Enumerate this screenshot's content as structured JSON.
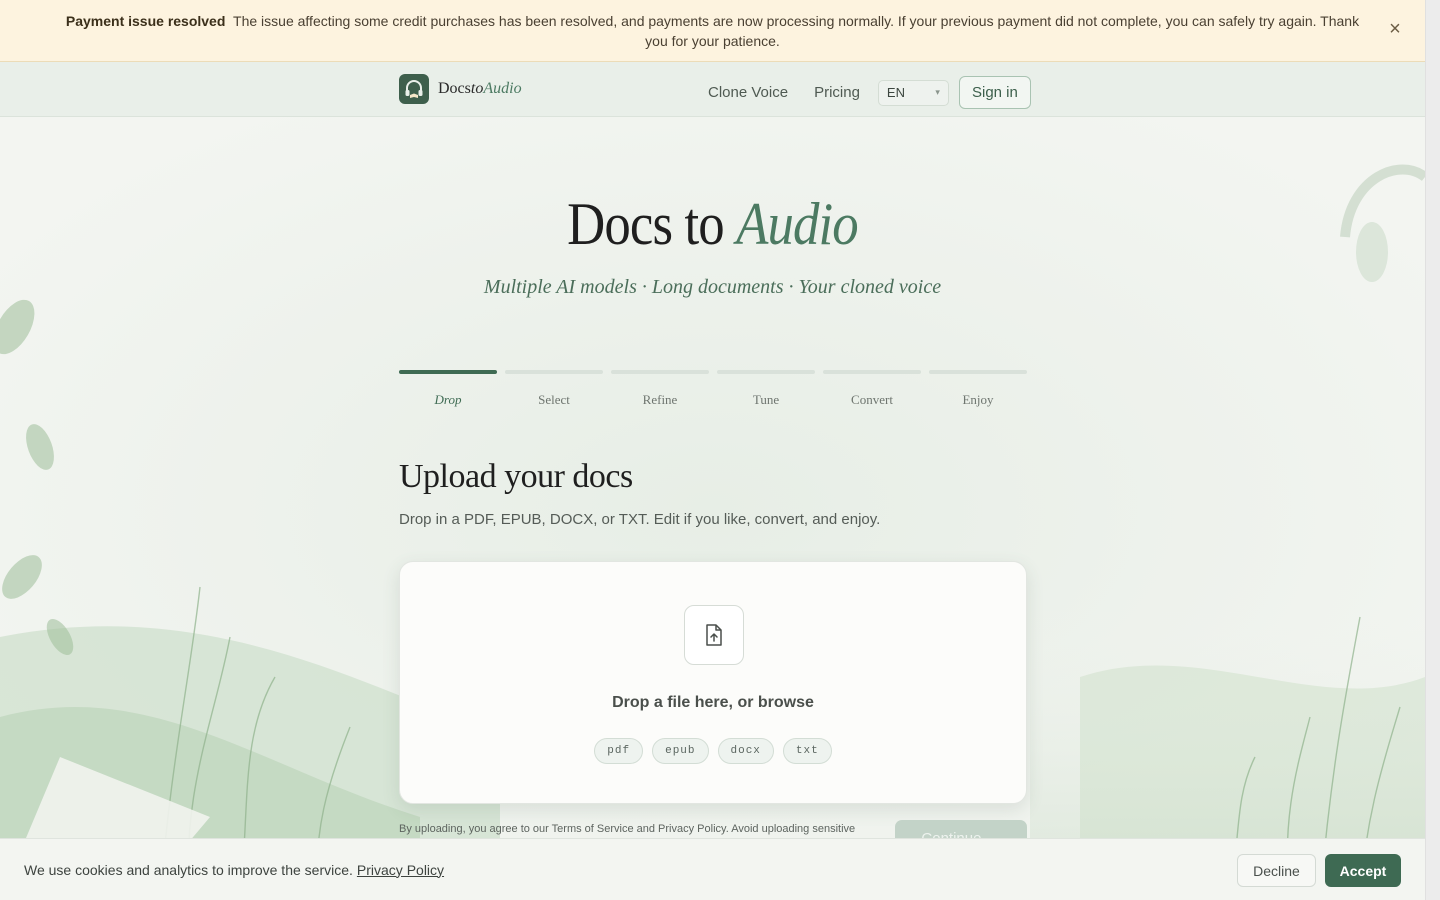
{
  "banner": {
    "title": "Payment issue resolved",
    "message": "The issue affecting some credit purchases has been resolved, and payments are now processing normally. If your previous payment did not complete, you can safely try again. Thank you for your patience.",
    "close_icon": "×"
  },
  "header": {
    "logo_docs": "Docs",
    "logo_to": "to",
    "logo_audio": "Audio",
    "nav": [
      "Clone Voice",
      "Pricing"
    ],
    "language": "EN",
    "signin_label": "Sign in"
  },
  "hero": {
    "title_main": "Docs to",
    "title_accent": "Audio",
    "tagline": "Multiple AI models · Long documents · Your cloned voice"
  },
  "steps": [
    {
      "label": "Drop",
      "active": true
    },
    {
      "label": "Select",
      "active": false
    },
    {
      "label": "Refine",
      "active": false
    },
    {
      "label": "Tune",
      "active": false
    },
    {
      "label": "Convert",
      "active": false
    },
    {
      "label": "Enjoy",
      "active": false
    }
  ],
  "upload": {
    "title": "Upload your docs",
    "description": "Drop in a PDF, EPUB, DOCX, or TXT. Edit if you like, convert, and enjoy.",
    "drop_text": "Drop a file here, or browse",
    "formats": [
      "pdf",
      "epub",
      "docx",
      "txt"
    ],
    "legal": "By uploading, you agree to our Terms of Service and Privacy Policy. Avoid uploading sensitive",
    "continue_label": "Continue →"
  },
  "cookie": {
    "text": "We use cookies and analytics to improve the service.",
    "link": "Privacy Policy",
    "decline_label": "Decline",
    "accept_label": "Accept"
  },
  "colors": {
    "accent": "#4c7a62",
    "primary_button": "#3e6a53",
    "banner_bg": "#fdf3df"
  }
}
